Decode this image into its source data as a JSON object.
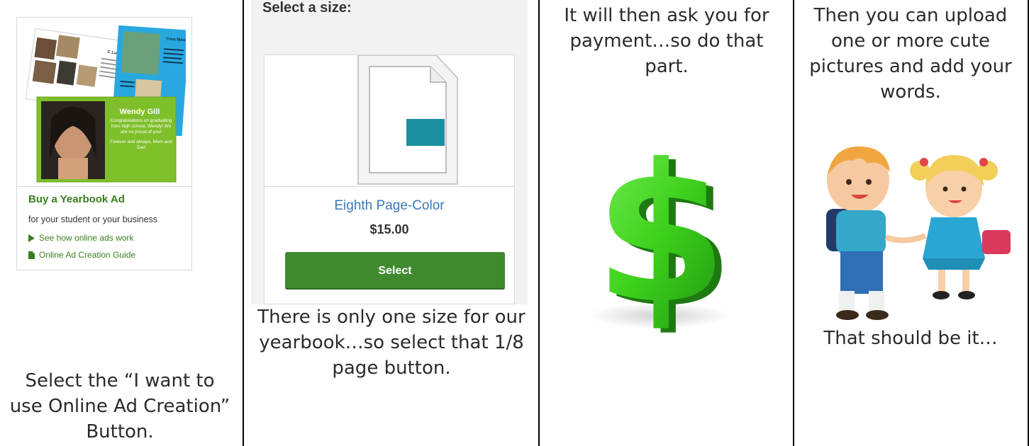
{
  "columns": [
    {
      "caption": "Select the “I want to use Online Ad Creation” Button.",
      "card": {
        "thumbnail": {
          "name_banner": "Wendy Gill",
          "message": "Congratulations on graduating from high school, Wendy! We are so proud of you!",
          "signoff": "Forever and always, Mom and Dad",
          "tile_left_title": "C Lunch Crew",
          "tile_right_title": "Cora Meadit"
        },
        "title": "Buy a Yearbook Ad",
        "subtitle": "for your student or your business",
        "links": [
          {
            "icon": "play-triangle-icon",
            "label": "See how online ads work"
          },
          {
            "icon": "document-icon",
            "label": "Online Ad Creation Guide"
          }
        ]
      }
    },
    {
      "header": "Select a size:",
      "product": {
        "name": "Eighth Page-Color",
        "price": "$15.00",
        "button": "Select"
      },
      "caption": "There is only one size for our yearbook…so select that 1/8 page button."
    },
    {
      "caption": "It will then ask you for payment…so do that part."
    },
    {
      "caption_top": "Then you can upload one or more cute pictures and add your words.",
      "caption_bottom": "That should be it…"
    }
  ],
  "colors": {
    "ad_green": "#3b7d1e",
    "button_green": "#3f8a2e",
    "link_blue": "#3a78b8",
    "teal_block": "#1b8fa0",
    "dollar_green": "#3dd11c"
  }
}
